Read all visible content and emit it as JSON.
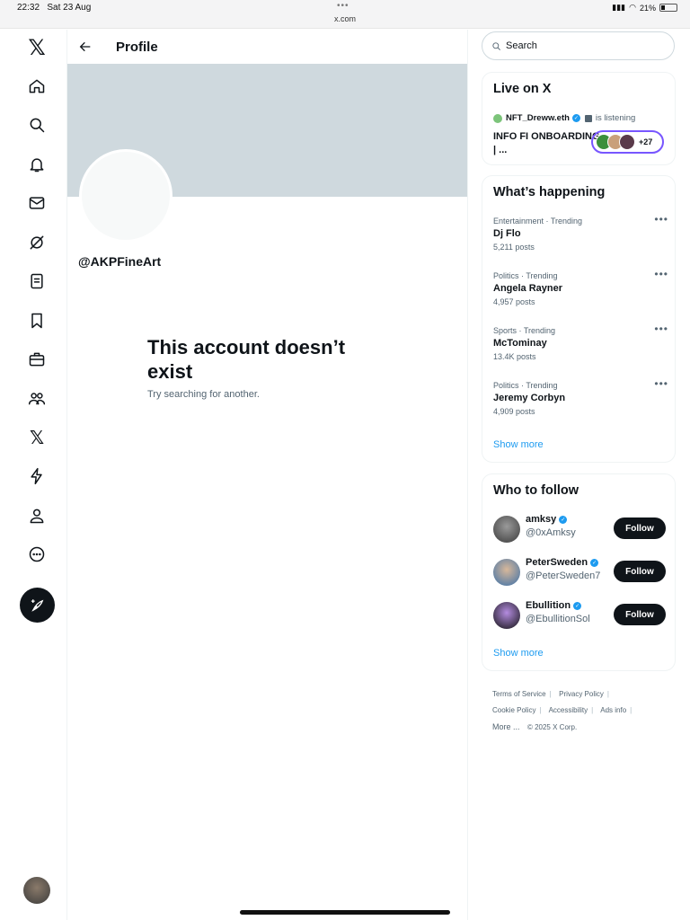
{
  "status_bar": {
    "time": "22:32",
    "date": "Sat 23 Aug",
    "url": "x.com",
    "battery": "21%"
  },
  "nav": [
    "x-logo",
    "home-icon",
    "explore-icon",
    "notifications-icon",
    "messages-icon",
    "grok-icon",
    "lists-icon",
    "bookmarks-icon",
    "jobs-icon",
    "communities-icon",
    "premium-icon",
    "verified-orgs-icon",
    "profile-icon",
    "more-icon"
  ],
  "header": {
    "title": "Profile"
  },
  "profile": {
    "handle": "@AKPFineArt"
  },
  "not_found": {
    "title": "This account doesn’t exist",
    "subtitle": "Try searching for another."
  },
  "search": {
    "placeholder": "Search"
  },
  "live": {
    "title": "Live on X",
    "host": "NFT_Dreww.eth",
    "status": "is listening",
    "space_title": "INFO FI ONBOARDING | ...",
    "listener_count": "+27"
  },
  "happening": {
    "title": "What’s happening",
    "trends": [
      {
        "category": "Entertainment · Trending",
        "name": "Dj Flo",
        "posts": "5,211 posts"
      },
      {
        "category": "Politics · Trending",
        "name": "Angela Rayner",
        "posts": "4,957 posts"
      },
      {
        "category": "Sports · Trending",
        "name": "McTominay",
        "posts": "13.4K posts"
      },
      {
        "category": "Politics · Trending",
        "name": "Jeremy Corbyn",
        "posts": "4,909 posts"
      }
    ],
    "show_more": "Show more"
  },
  "who_to_follow": {
    "title": "Who to follow",
    "accounts": [
      {
        "name": "amksy",
        "handle": "@0xAmksy",
        "button": "Follow"
      },
      {
        "name": "PeterSweden",
        "handle": "@PeterSweden7",
        "button": "Follow"
      },
      {
        "name": "Ebullition",
        "handle": "@EbullitionSol",
        "button": "Follow"
      }
    ],
    "show_more": "Show more"
  },
  "footer": {
    "links": [
      "Terms of Service",
      "Privacy Policy",
      "Cookie Policy",
      "Accessibility",
      "Ads info",
      "More ..."
    ],
    "copyright": "© 2025 X Corp."
  }
}
